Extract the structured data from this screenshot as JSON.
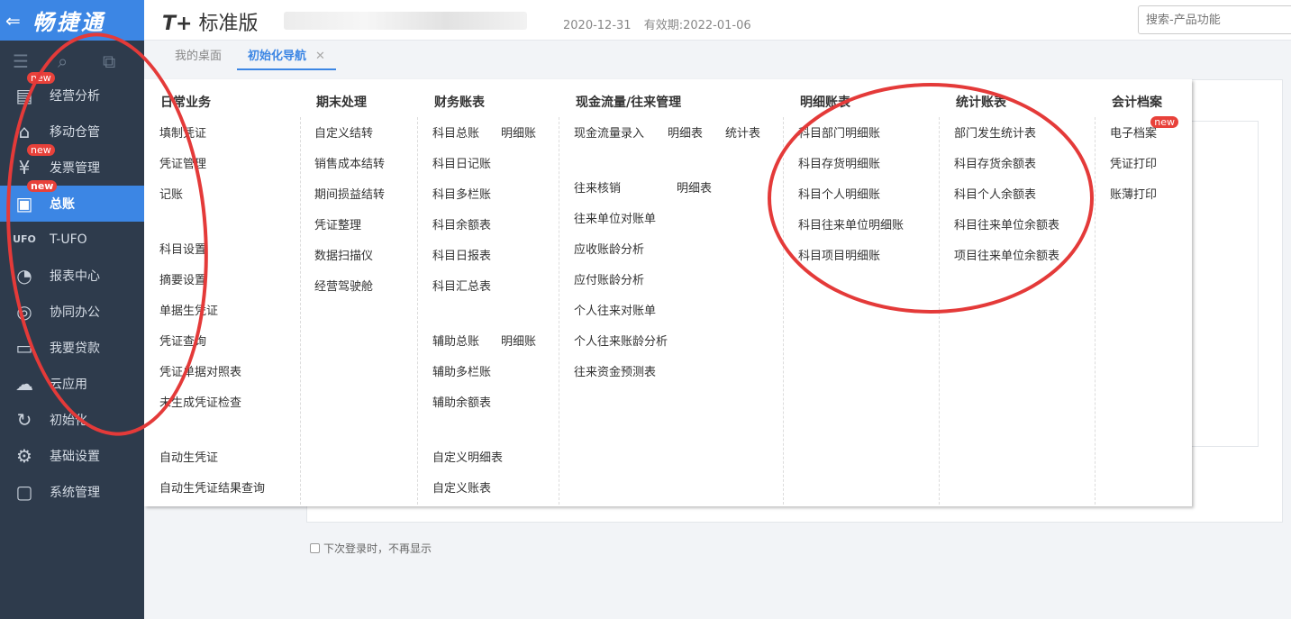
{
  "brand": {
    "back_icon": "arrow-left-icon",
    "name": "畅捷通"
  },
  "sidebar": {
    "items": [
      {
        "label": "经营分析",
        "icon": "analysis-icon",
        "badge": "new"
      },
      {
        "label": "移动仓管",
        "icon": "warehouse-icon",
        "badge": ""
      },
      {
        "label": "发票管理",
        "icon": "invoice-icon",
        "badge": "new"
      },
      {
        "label": "总账",
        "icon": "ledger-icon",
        "badge": "new",
        "active": true
      },
      {
        "label": "T-UFO",
        "icon": "ufo-icon",
        "badge": ""
      },
      {
        "label": "报表中心",
        "icon": "pie-chart-icon",
        "badge": ""
      },
      {
        "label": "协同办公",
        "icon": "collaboration-icon",
        "badge": ""
      },
      {
        "label": "我要贷款",
        "icon": "loan-icon",
        "badge": ""
      },
      {
        "label": "云应用",
        "icon": "cloud-icon",
        "badge": ""
      },
      {
        "label": "初始化",
        "icon": "refresh-icon",
        "badge": ""
      },
      {
        "label": "基础设置",
        "icon": "settings-icon",
        "badge": ""
      },
      {
        "label": "系统管理",
        "icon": "monitor-icon",
        "badge": ""
      }
    ]
  },
  "header": {
    "product_prefix": "T+",
    "product_name": "标准版",
    "date": "2020-12-31",
    "validity": "有效期:2022-01-06",
    "search_placeholder": "搜索-产品功能"
  },
  "tabs": [
    {
      "label": "我的桌面"
    },
    {
      "label": "初始化导航",
      "active": true,
      "close": "✕"
    }
  ],
  "footer": {
    "dont_show": "下次登录时，不再显示"
  },
  "menu": {
    "columns": [
      {
        "title": "日常业务",
        "items": [
          "填制凭证",
          "凭证管理",
          "记账",
          "科目设置",
          "摘要设置",
          "单据生凭证",
          "凭证查询",
          "凭证单据对照表",
          "未生成凭证检查",
          "自动生凭证",
          "自动生凭证结果查询"
        ]
      },
      {
        "title": "期末处理",
        "items": [
          "自定义结转",
          "销售成本结转",
          "期间损益结转",
          "凭证整理",
          "数据扫描仪",
          "经营驾驶舱"
        ]
      },
      {
        "title": "财务账表",
        "items": [
          "科目总账",
          "明细账",
          "科目日记账",
          "科目多栏账",
          "科目余额表",
          "科目日报表",
          "科目汇总表",
          "辅助总账",
          "明细账",
          "辅助多栏账",
          "辅助余额表",
          "自定义明细表",
          "自定义账表"
        ]
      },
      {
        "title": "现金流量/往来管理",
        "items": [
          "现金流量录入",
          "明细表",
          "统计表",
          "往来核销",
          "明细表",
          "往来单位对账单",
          "应收账龄分析",
          "应付账龄分析",
          "个人往来对账单",
          "个人往来账龄分析",
          "往来资金预测表"
        ]
      },
      {
        "title": "明细账表",
        "items": [
          "科目部门明细账",
          "科目存货明细账",
          "科目个人明细账",
          "科目往来单位明细账",
          "科目项目明细账"
        ]
      },
      {
        "title": "统计账表",
        "items": [
          "部门发生统计表",
          "科目存货余额表",
          "科目个人余额表",
          "科目往来单位余额表",
          "项目往来单位余额表"
        ]
      },
      {
        "title": "会计档案",
        "items": [
          "电子档案",
          "凭证打印",
          "账薄打印"
        ],
        "badge": "new"
      }
    ]
  },
  "colors": {
    "accent": "#3c86e4",
    "sidebar": "#2e3b4c",
    "annotation": "#e43a39",
    "badge": "#e8413a"
  }
}
